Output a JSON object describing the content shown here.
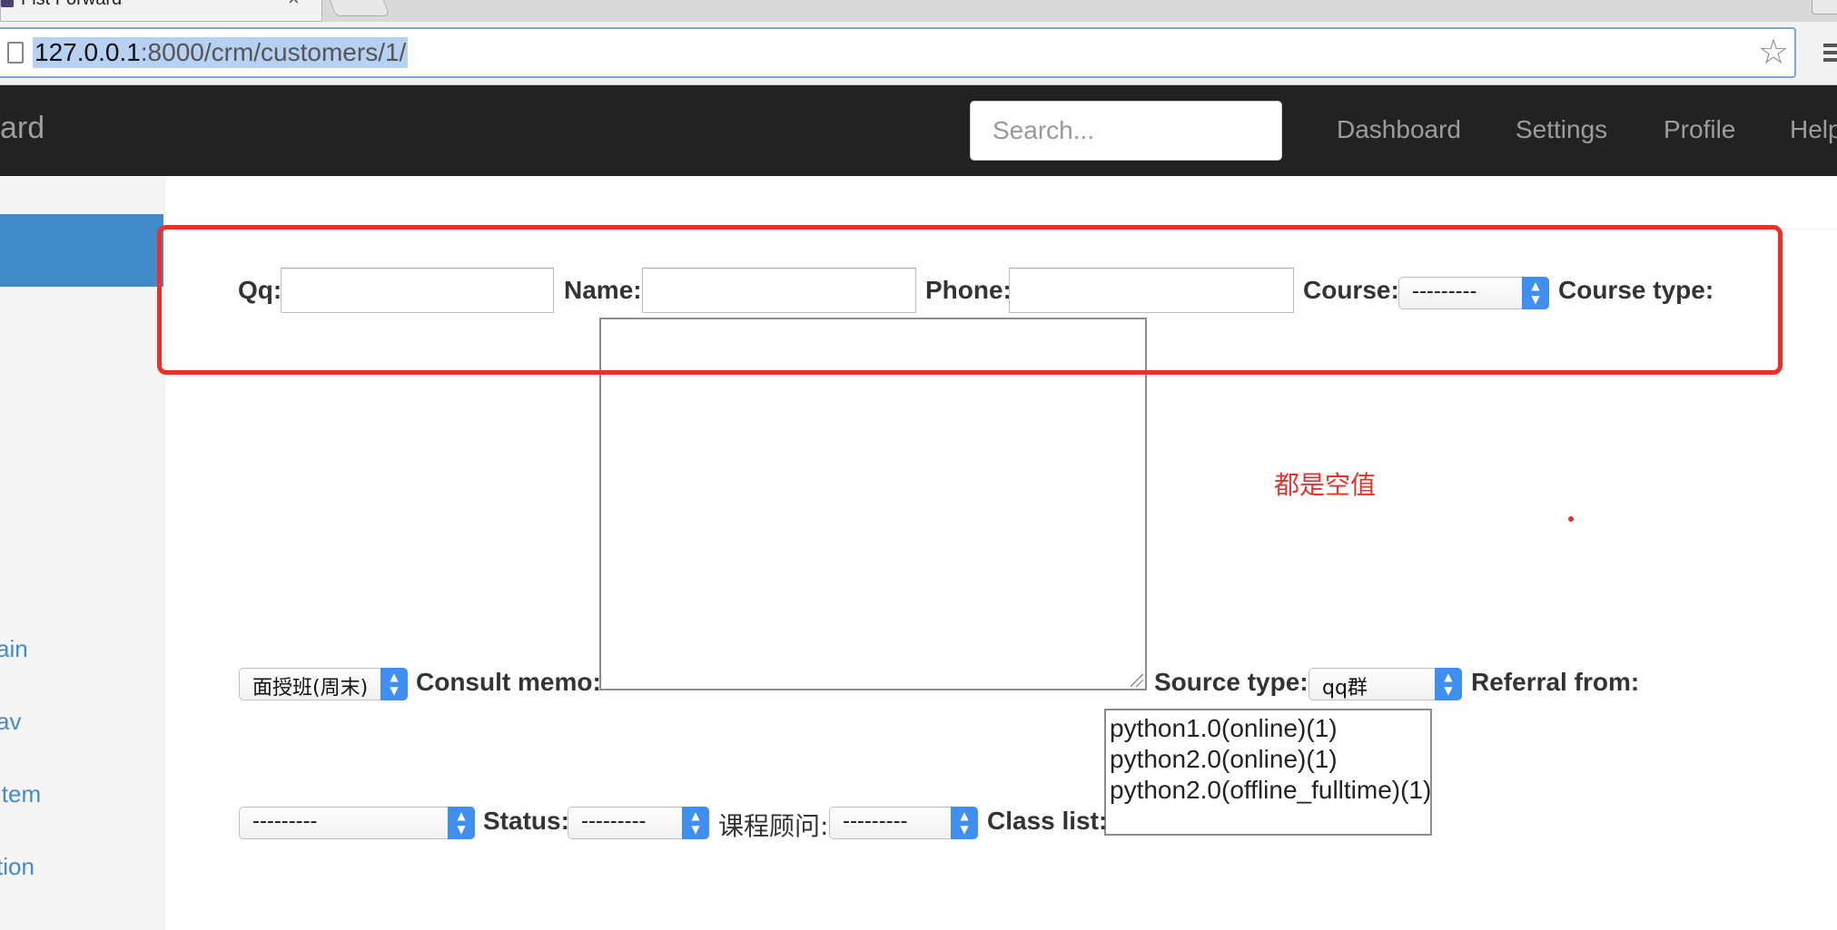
{
  "browser": {
    "tab_title": "Fist Forward",
    "tab_close": "×",
    "url_host": "127.0.0.1",
    "url_path": ":8000/crm/customers/1/"
  },
  "navbar": {
    "brand": "ard",
    "search_placeholder": "Search...",
    "links": [
      "Dashboard",
      "Settings",
      "Profile",
      "Help"
    ]
  },
  "sidebar": {
    "items": [
      "ain",
      "av",
      " item",
      "tion"
    ]
  },
  "form": {
    "qq_label": "Qq:",
    "name_label": "Name:",
    "phone_label": "Phone:",
    "course_label": "Course:",
    "course_value": "---------",
    "course_type_label": "Course type:",
    "course_type_value": "面授班(周末)",
    "consult_memo_label": "Consult memo:",
    "source_type_label": "Source type:",
    "source_type_value": "qq群",
    "referral_from_label": "Referral from:",
    "referral_from_value": "---------",
    "status_label": "Status:",
    "status_value": "---------",
    "consultant_label": "课程顾问:",
    "consultant_value": "---------",
    "class_list_label": "Class list:",
    "class_list_options": [
      "python1.0(online)(1)",
      "python2.0(online)(1)",
      "python2.0(offline_fulltime)(1)"
    ]
  },
  "annotation": {
    "note": "都是空值",
    "color": "#e8312b"
  }
}
